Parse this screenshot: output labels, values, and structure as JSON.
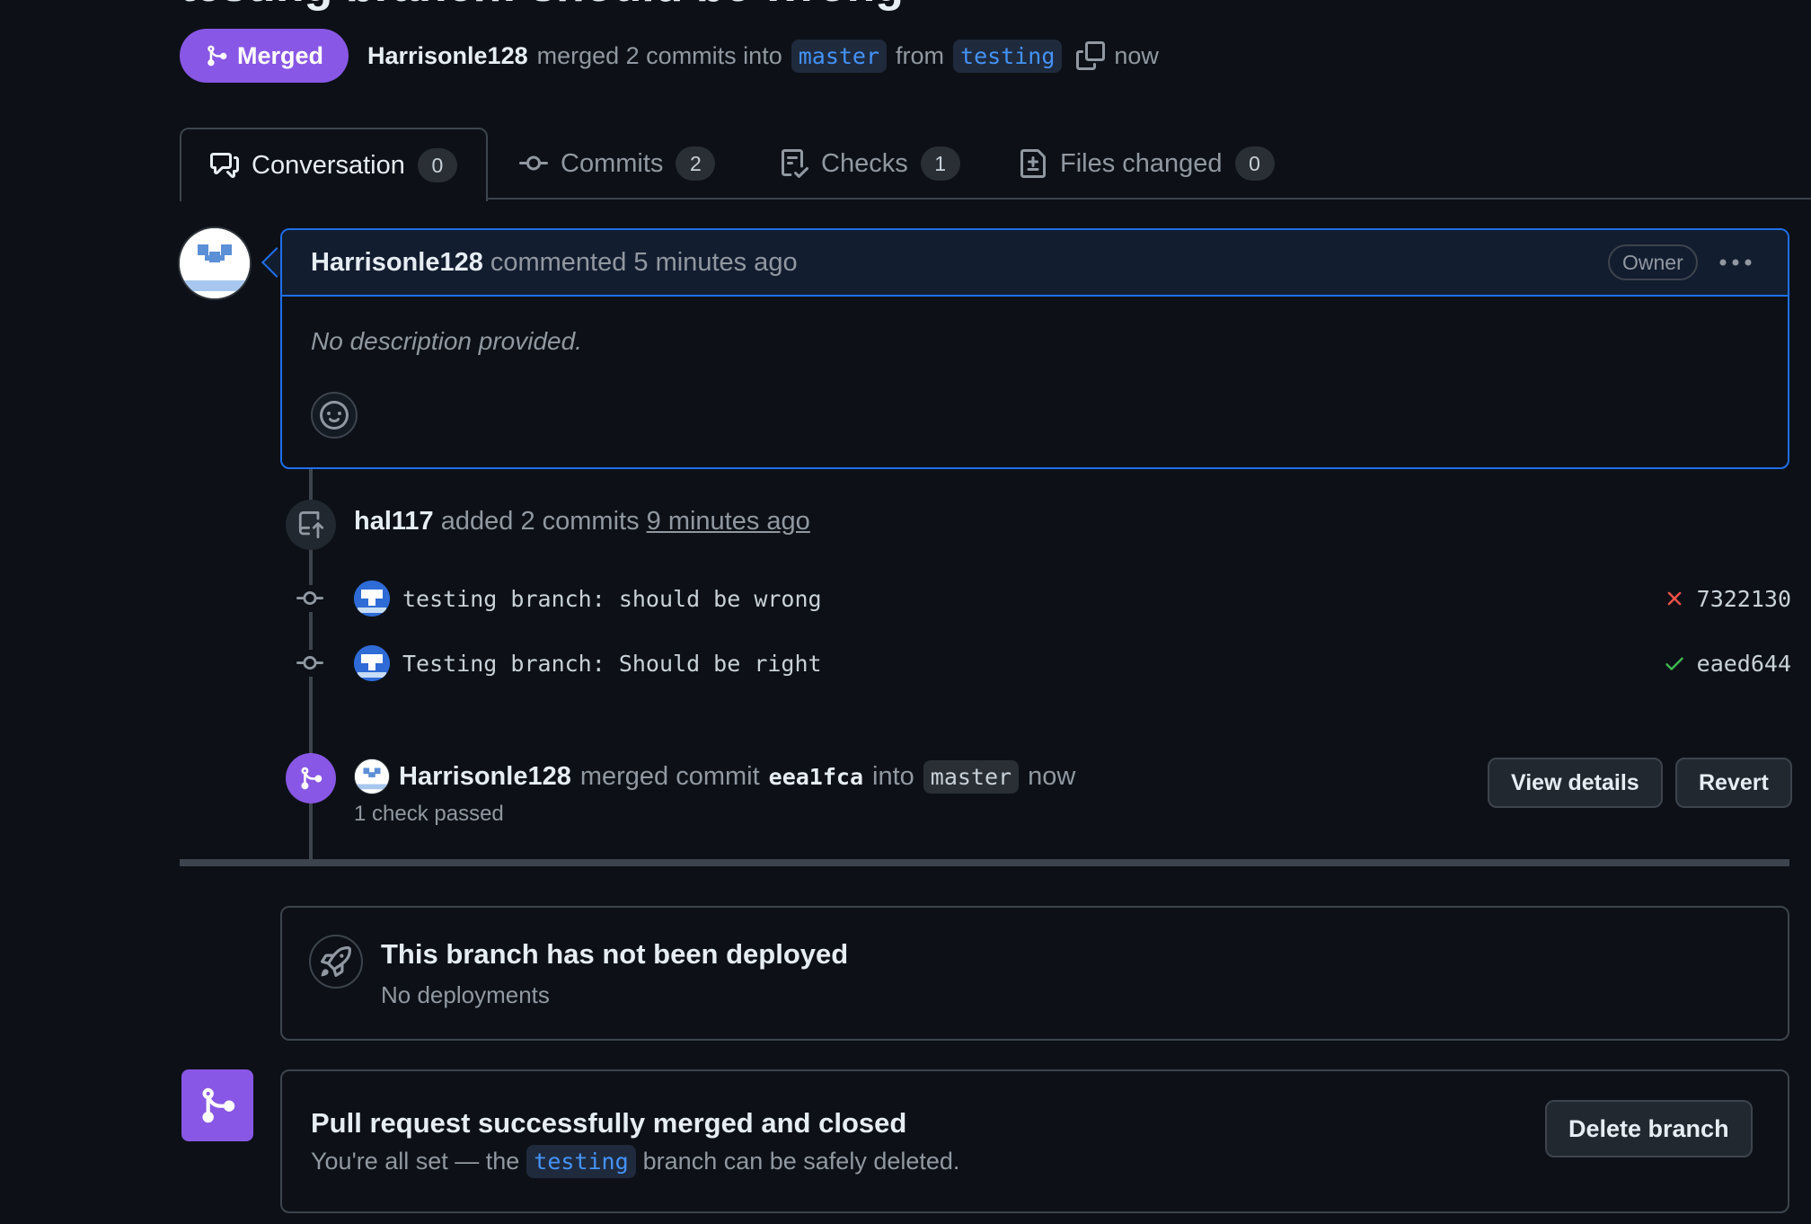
{
  "header": {
    "title_cut": "testing branch: should be wrong",
    "state_label": "Merged",
    "author": "Harrisonle128",
    "merged_text": "merged 2 commits into",
    "base_branch": "master",
    "from_text": "from",
    "head_branch": "testing",
    "time": "now"
  },
  "tabs": [
    {
      "label": "Conversation",
      "count": "0"
    },
    {
      "label": "Commits",
      "count": "2"
    },
    {
      "label": "Checks",
      "count": "1"
    },
    {
      "label": "Files changed",
      "count": "0"
    }
  ],
  "comment": {
    "author": "Harrisonle128",
    "action": "commented 5 minutes ago",
    "badge": "Owner",
    "body": "No description provided."
  },
  "push_event": {
    "actor": "hal117",
    "text": "added 2 commits",
    "time": "9 minutes ago"
  },
  "commits": [
    {
      "message": "testing branch: should be wrong",
      "status": "fail",
      "sha": "7322130"
    },
    {
      "message": "Testing branch: Should be right",
      "status": "pass",
      "sha": "eaed644"
    }
  ],
  "merge_event": {
    "actor": "Harrisonle128",
    "text1": "merged commit",
    "sha": "eea1fca",
    "text2": "into",
    "branch": "master",
    "time": "now",
    "checks": "1 check passed",
    "view_details_label": "View details",
    "revert_label": "Revert"
  },
  "deployment": {
    "title": "This branch has not been deployed",
    "subtitle": "No deployments"
  },
  "merge_status": {
    "title": "Pull request successfully merged and closed",
    "sub_before": "You're all set — the",
    "branch": "testing",
    "sub_after": "branch can be safely deleted.",
    "delete_label": "Delete branch"
  },
  "colors": {
    "merged_purple": "#8957e5",
    "accent_blue": "#4493f8",
    "fail_red": "#f85149",
    "pass_green": "#3fb950",
    "background": "#0d1117"
  }
}
